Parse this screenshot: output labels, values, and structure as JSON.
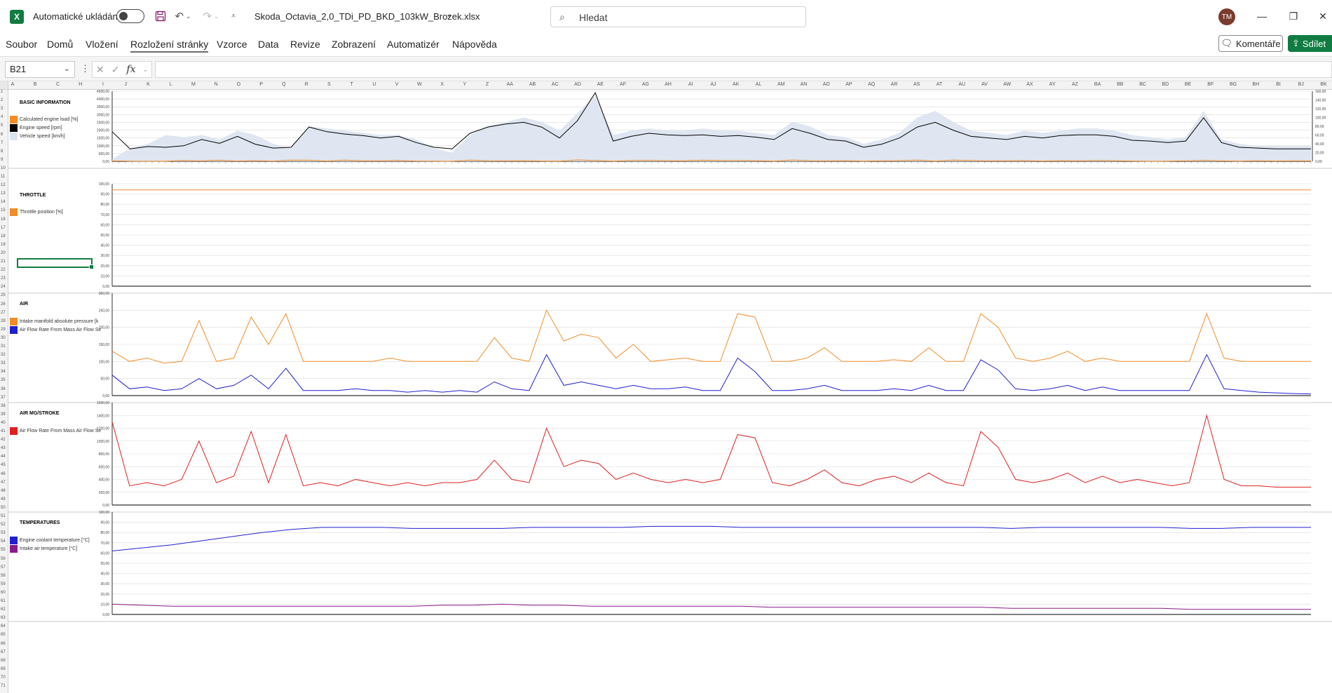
{
  "titlebar": {
    "autosave_label": "Automatické ukládání",
    "filename": "Skoda_Octavia_2,0_TDi_PD_BKD_103kW_Brozek.xlsx",
    "search_placeholder": "Hledat",
    "avatar_initials": "TM"
  },
  "menu": {
    "tabs": [
      "Soubor",
      "Domů",
      "Vložení",
      "Rozložení stránky",
      "Vzorce",
      "Data",
      "Revize",
      "Zobrazení",
      "Automatizér",
      "Nápověda"
    ],
    "active_tab": "Rozložení stránky",
    "comments_label": "Komentáře",
    "share_label": "Sdílet"
  },
  "formulabar": {
    "name_box": "B21",
    "formula": ""
  },
  "sheet": {
    "col_letters": [
      "A",
      "B",
      "C",
      "H",
      "I",
      "J",
      "K",
      "L",
      "M",
      "N",
      "O",
      "P",
      "Q",
      "R",
      "S",
      "T",
      "U",
      "V",
      "W",
      "X",
      "Y",
      "Z",
      "AA",
      "AB",
      "AC",
      "AD",
      "AE",
      "AF",
      "AG",
      "AH",
      "AI",
      "AJ",
      "AK",
      "AL",
      "AM",
      "AN",
      "AO",
      "AP",
      "AQ",
      "AR",
      "AS",
      "AT",
      "AU",
      "AV",
      "AW",
      "AX",
      "AY",
      "AZ",
      "BA",
      "BB",
      "BC",
      "BD",
      "BE",
      "BF",
      "BG",
      "BH",
      "BI",
      "BJ",
      "BK"
    ],
    "row_count": 71
  },
  "sections": [
    {
      "title": "BASIC INFORMATION",
      "legend": [
        {
          "label": "Calculated engine load [%]",
          "color": "#f28c28"
        },
        {
          "label": "Engine speed [rpm]",
          "color": "#000000"
        },
        {
          "label": "Vehicle speed [km/h]",
          "color": "#dce3f0"
        }
      ]
    },
    {
      "title": "THROTTLE",
      "legend": [
        {
          "label": "Throttle position [%]",
          "color": "#f28c28"
        }
      ]
    },
    {
      "title": "AIR",
      "legend": [
        {
          "label": "Intake manifold absolute pressure [k",
          "color": "#f28c28"
        },
        {
          "label": "Air Flow Rate From Mass Air Flow Se",
          "color": "#1f1fd0"
        }
      ]
    },
    {
      "title": "AIR MG/STROKE",
      "legend": [
        {
          "label": "Air Flow Rate From Mass Air Flow Se",
          "color": "#e02020"
        }
      ]
    },
    {
      "title": "TEMPERATURES",
      "legend": [
        {
          "label": "Engine coolant temperature [°C]",
          "color": "#1f1fd0"
        },
        {
          "label": "Intake air temperature [°C]",
          "color": "#8b1a8b"
        }
      ]
    }
  ],
  "chart_data": [
    {
      "type": "line",
      "y_ticks": [
        "4500,00",
        "4000,00",
        "3500,00",
        "3000,00",
        "2500,00",
        "2000,00",
        "1500,00",
        "1000,00",
        "500,00",
        "0,00"
      ],
      "y2_ticks": [
        "160,00",
        "140,00",
        "120,00",
        "100,00",
        "80,00",
        "60,00",
        "40,00",
        "20,00",
        "0,00"
      ],
      "ylim": [
        0,
        4500
      ],
      "y2lim": [
        0,
        160
      ],
      "series": [
        {
          "name": "Engine speed [rpm]",
          "color": "#000000",
          "values": [
            1900,
            800,
            950,
            900,
            1000,
            1400,
            1150,
            1600,
            1100,
            850,
            900,
            2200,
            1900,
            1750,
            1650,
            1500,
            1600,
            1200,
            900,
            800,
            1800,
            2200,
            2400,
            2500,
            2200,
            1500,
            2600,
            4400,
            1300,
            1600,
            1800,
            1700,
            1650,
            1700,
            1600,
            1650,
            1550,
            1400,
            2100,
            1800,
            1400,
            1300,
            900,
            1100,
            1500,
            2200,
            2500,
            2000,
            1600,
            1500,
            1400,
            1600,
            1500,
            1650,
            1700,
            1700,
            1600,
            1350,
            1300,
            1200,
            1300,
            2800,
            1200,
            900,
            850,
            800,
            800,
            800
          ]
        },
        {
          "name": "Calculated engine load [%]",
          "color": "#f28c28",
          "values": [
            40,
            10,
            5,
            5,
            60,
            25,
            70,
            20,
            50,
            10,
            80,
            70,
            20,
            75,
            35,
            30,
            55,
            20,
            10,
            5,
            75,
            40,
            30,
            40,
            20,
            10,
            90,
            60,
            10,
            55,
            60,
            45,
            40,
            70,
            50,
            50,
            45,
            10,
            85,
            40,
            30,
            45,
            10,
            30,
            45,
            80,
            10,
            75,
            50,
            35,
            40,
            50,
            20,
            45,
            35,
            50,
            45,
            20,
            5,
            10,
            30,
            65,
            25,
            10,
            45,
            20,
            30,
            25
          ]
        }
      ],
      "area": {
        "name": "Vehicle speed [km/h]",
        "color": "#dce3f0",
        "values": [
          5,
          30,
          40,
          60,
          55,
          60,
          50,
          70,
          60,
          40,
          30,
          80,
          75,
          70,
          65,
          60,
          60,
          50,
          30,
          20,
          60,
          80,
          90,
          100,
          90,
          70,
          110,
          150,
          60,
          70,
          75,
          70,
          70,
          75,
          70,
          70,
          65,
          60,
          90,
          80,
          60,
          55,
          40,
          50,
          65,
          100,
          115,
          90,
          70,
          65,
          60,
          70,
          65,
          70,
          75,
          75,
          70,
          60,
          55,
          50,
          55,
          115,
          50,
          40,
          35,
          35,
          35,
          35
        ]
      }
    },
    {
      "type": "line",
      "y_ticks": [
        "100,00",
        "90,00",
        "80,00",
        "70,00",
        "60,00",
        "50,00",
        "40,00",
        "30,00",
        "20,00",
        "10,00",
        "0,00"
      ],
      "ylim": [
        0,
        100
      ],
      "series": [
        {
          "name": "Throttle position [%]",
          "color": "#f28c28",
          "values": [
            94,
            94
          ]
        }
      ]
    },
    {
      "type": "line",
      "y_ticks": [
        "300,00",
        "250,00",
        "200,00",
        "150,00",
        "100,00",
        "50,00",
        "0,00"
      ],
      "ylim": [
        0,
        300
      ],
      "series": [
        {
          "name": "Intake manifold absolute pressure [k",
          "color": "#f28c28",
          "values": [
            130,
            100,
            110,
            95,
            100,
            220,
            100,
            110,
            230,
            150,
            240,
            100,
            100,
            100,
            100,
            100,
            110,
            100,
            100,
            100,
            100,
            100,
            170,
            110,
            100,
            250,
            160,
            180,
            170,
            110,
            150,
            100,
            105,
            110,
            100,
            100,
            240,
            230,
            100,
            100,
            110,
            140,
            100,
            100,
            100,
            105,
            100,
            140,
            100,
            100,
            240,
            200,
            110,
            100,
            110,
            130,
            100,
            110,
            100,
            100,
            100,
            100,
            100,
            240,
            110,
            100,
            100,
            100,
            100,
            100
          ]
        },
        {
          "name": "Air Flow Rate From Mass Air Flow Se",
          "color": "#1f1fd0",
          "values": [
            60,
            20,
            25,
            15,
            20,
            50,
            20,
            30,
            60,
            20,
            80,
            15,
            15,
            15,
            20,
            15,
            15,
            10,
            15,
            10,
            15,
            10,
            40,
            20,
            15,
            120,
            30,
            40,
            30,
            20,
            30,
            20,
            20,
            25,
            15,
            15,
            110,
            70,
            15,
            15,
            20,
            30,
            15,
            15,
            15,
            20,
            15,
            30,
            15,
            15,
            105,
            75,
            20,
            15,
            20,
            30,
            15,
            25,
            15,
            15,
            15,
            15,
            15,
            120,
            20,
            15,
            10,
            8,
            6,
            5
          ]
        }
      ]
    },
    {
      "type": "line",
      "y_ticks": [
        "1600,00",
        "1400,00",
        "1200,00",
        "1000,00",
        "800,00",
        "600,00",
        "400,00",
        "200,00",
        "0,00"
      ],
      "ylim": [
        0,
        1600
      ],
      "series": [
        {
          "name": "Air Flow Rate From Mass Air Flow Se",
          "color": "#e02020",
          "values": [
            1300,
            300,
            350,
            300,
            400,
            1000,
            350,
            450,
            1150,
            350,
            1100,
            300,
            350,
            300,
            400,
            350,
            300,
            350,
            300,
            350,
            350,
            400,
            700,
            400,
            350,
            1200,
            600,
            700,
            650,
            400,
            500,
            400,
            350,
            400,
            350,
            400,
            1100,
            1050,
            350,
            300,
            400,
            550,
            350,
            300,
            400,
            450,
            350,
            500,
            350,
            300,
            1150,
            900,
            400,
            350,
            400,
            500,
            350,
            450,
            350,
            400,
            350,
            300,
            350,
            1400,
            400,
            300,
            300,
            280,
            280,
            280
          ]
        }
      ]
    },
    {
      "type": "line",
      "y_ticks": [
        "100,00",
        "90,00",
        "80,00",
        "70,00",
        "60,00",
        "50,00",
        "40,00",
        "30,00",
        "20,00",
        "10,00",
        "0,00"
      ],
      "ylim": [
        0,
        100
      ],
      "series": [
        {
          "name": "Engine coolant temperature [°C]",
          "color": "#1f1fd0",
          "values": [
            62,
            65,
            68,
            72,
            76,
            80,
            83,
            85,
            85,
            85,
            84,
            84,
            84,
            84,
            85,
            85,
            85,
            85,
            86,
            86,
            86,
            85,
            85,
            85,
            85,
            85,
            85,
            85,
            85,
            85,
            84,
            85,
            85,
            85,
            85,
            85,
            84,
            84,
            85,
            85,
            85
          ]
        },
        {
          "name": "Intake air temperature [°C]",
          "color": "#8b1a8b",
          "values": [
            10,
            9,
            8,
            8,
            8,
            8,
            8,
            8,
            8,
            8,
            8,
            9,
            9,
            10,
            9,
            9,
            8,
            8,
            8,
            8,
            8,
            8,
            7,
            7,
            7,
            7,
            7,
            7,
            7,
            7,
            6,
            6,
            6,
            6,
            6,
            6,
            5,
            5,
            5,
            5,
            5
          ]
        }
      ]
    }
  ]
}
